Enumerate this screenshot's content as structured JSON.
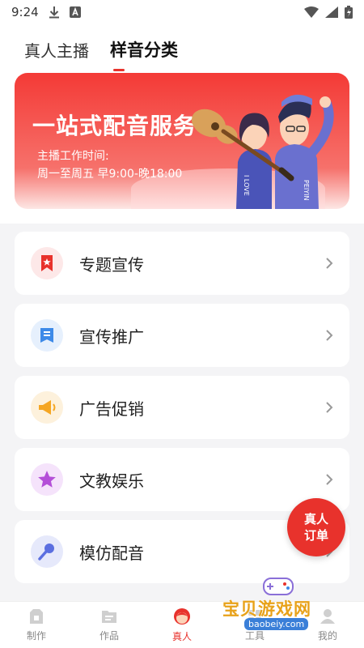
{
  "status_bar": {
    "time": "9:24"
  },
  "tabs": [
    {
      "label": "真人主播",
      "active": false
    },
    {
      "label": "样音分类",
      "active": true
    }
  ],
  "banner": {
    "title": "一站式配音服务",
    "subtitle": "主播工作时间:",
    "hours": "周一至周五 早9:00-晚18:00",
    "art_text_1": "I LOVE",
    "art_text_2": "PEIYIN"
  },
  "categories": [
    {
      "label": "专题宣传",
      "icon": "bookmark-star-icon",
      "color": "#e8322c"
    },
    {
      "label": "宣传推广",
      "icon": "doc-list-icon",
      "color": "#3d8ae8"
    },
    {
      "label": "广告促销",
      "icon": "megaphone-icon",
      "color": "#f5a623"
    },
    {
      "label": "文教娱乐",
      "icon": "star-icon",
      "color": "#b44fd8"
    },
    {
      "label": "模仿配音",
      "icon": "microphone-icon",
      "color": "#5b6fe0"
    }
  ],
  "fab": {
    "line1": "真人",
    "line2": "订单"
  },
  "bottom_nav": [
    {
      "label": "制作",
      "icon": "make-icon",
      "active": false
    },
    {
      "label": "作品",
      "icon": "works-icon",
      "active": false
    },
    {
      "label": "真人",
      "icon": "person-icon",
      "active": true
    },
    {
      "label": "工具",
      "icon": "tools-icon",
      "active": false
    },
    {
      "label": "我的",
      "icon": "profile-icon",
      "active": false
    }
  ],
  "watermark": {
    "text": "宝贝游戏网",
    "url": "baobeiy.com"
  },
  "colors": {
    "accent": "#e8322c"
  }
}
